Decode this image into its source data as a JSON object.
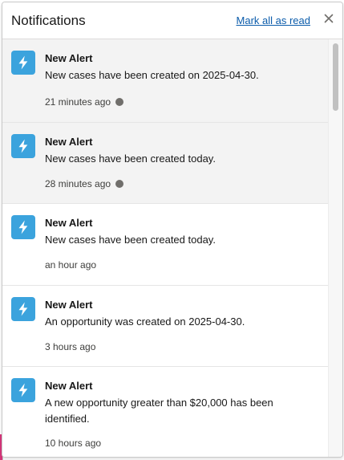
{
  "header": {
    "title": "Notifications",
    "mark_all_read": "Mark all as read",
    "close_icon": "close-icon"
  },
  "notifications": [
    {
      "icon": "lightning-bolt-icon",
      "title": "New Alert",
      "body": "New cases have been created on 2025-04-30.",
      "time": "21 minutes ago",
      "unread": true
    },
    {
      "icon": "lightning-bolt-icon",
      "title": "New Alert",
      "body": "New cases have been created today.",
      "time": "28 minutes ago",
      "unread": true
    },
    {
      "icon": "lightning-bolt-icon",
      "title": "New Alert",
      "body": "New cases have been created today.",
      "time": "an hour ago",
      "unread": false
    },
    {
      "icon": "lightning-bolt-icon",
      "title": "New Alert",
      "body": "An opportunity was created on 2025-04-30.",
      "time": "3 hours ago",
      "unread": false
    },
    {
      "icon": "lightning-bolt-icon",
      "title": "New Alert",
      "body": "A new opportunity greater than $20,000 has been identified.",
      "time": "10 hours ago",
      "unread": false
    }
  ],
  "colors": {
    "icon_background": "#3ba3dd",
    "unread_background": "#f3f3f3",
    "link": "#0b5cab",
    "unread_dot": "#706e6b"
  }
}
